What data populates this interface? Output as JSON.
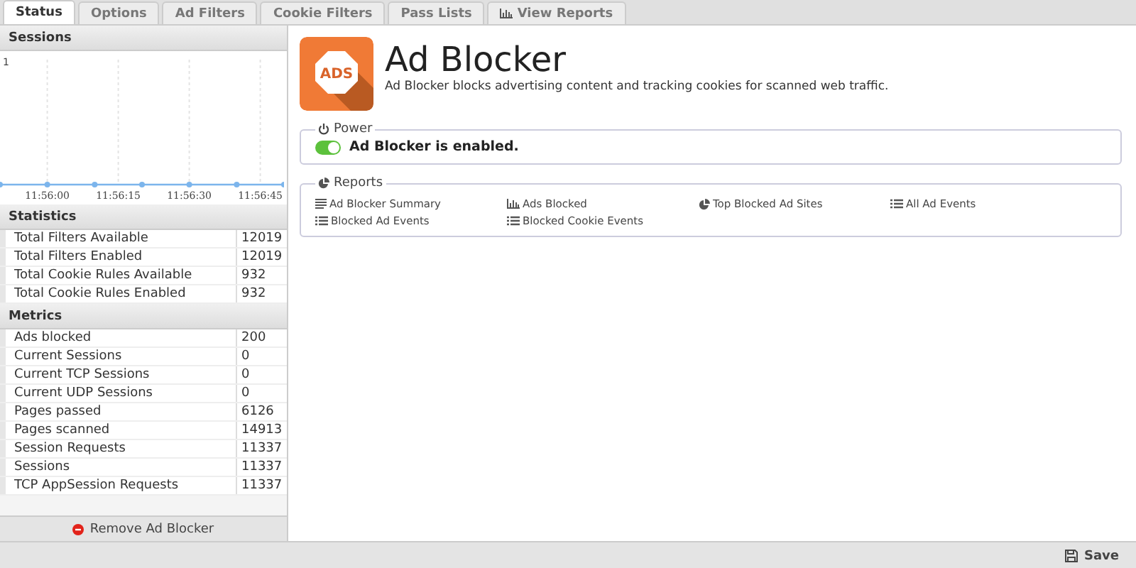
{
  "tabs": [
    {
      "label": "Status",
      "selected": true
    },
    {
      "label": "Options",
      "selected": false
    },
    {
      "label": "Ad Filters",
      "selected": false
    },
    {
      "label": "Cookie Filters",
      "selected": false
    },
    {
      "label": "Pass Lists",
      "selected": false
    },
    {
      "label": "View Reports",
      "selected": false,
      "kind": "reports"
    }
  ],
  "sessions": {
    "title": "Sessions",
    "y_label": "1",
    "time_labels": [
      "11:56:00",
      "11:56:15",
      "11:56:30",
      "11:56:45"
    ]
  },
  "statistics": {
    "title": "Statistics",
    "rows": [
      {
        "name": "Total Filters Available",
        "value": "12019"
      },
      {
        "name": "Total Filters Enabled",
        "value": "12019"
      },
      {
        "name": "Total Cookie Rules Available",
        "value": "932"
      },
      {
        "name": "Total Cookie Rules Enabled",
        "value": "932"
      }
    ]
  },
  "metrics": {
    "title": "Metrics",
    "rows": [
      {
        "name": "Ads blocked",
        "value": "200"
      },
      {
        "name": "Current Sessions",
        "value": "0"
      },
      {
        "name": "Current TCP Sessions",
        "value": "0"
      },
      {
        "name": "Current UDP Sessions",
        "value": "0"
      },
      {
        "name": "Pages passed",
        "value": "6126"
      },
      {
        "name": "Pages scanned",
        "value": "14913"
      },
      {
        "name": "Session Requests",
        "value": "11337"
      },
      {
        "name": "Sessions",
        "value": "11337"
      },
      {
        "name": "TCP AppSession Requests",
        "value": "11337"
      }
    ]
  },
  "remove_button": "Remove Ad Blocker",
  "app": {
    "logo": "ADS",
    "title": "Ad Blocker",
    "description": "Ad Blocker blocks advertising content and tracking cookies for scanned web traffic."
  },
  "power": {
    "title": "Power",
    "status": "Ad Blocker is enabled.",
    "on": true
  },
  "reports": {
    "title": "Reports",
    "links": [
      {
        "label": "Ad Blocker Summary",
        "kind": "lines"
      },
      {
        "label": "Ads Blocked",
        "kind": "bar"
      },
      {
        "label": "Top Blocked Ad Sites",
        "kind": "pie"
      },
      {
        "label": "All Ad Events",
        "kind": "list"
      },
      {
        "label": "Blocked Ad Events",
        "kind": "list"
      },
      {
        "label": "Blocked Cookie Events",
        "kind": "list"
      }
    ]
  },
  "save_button": "Save"
}
